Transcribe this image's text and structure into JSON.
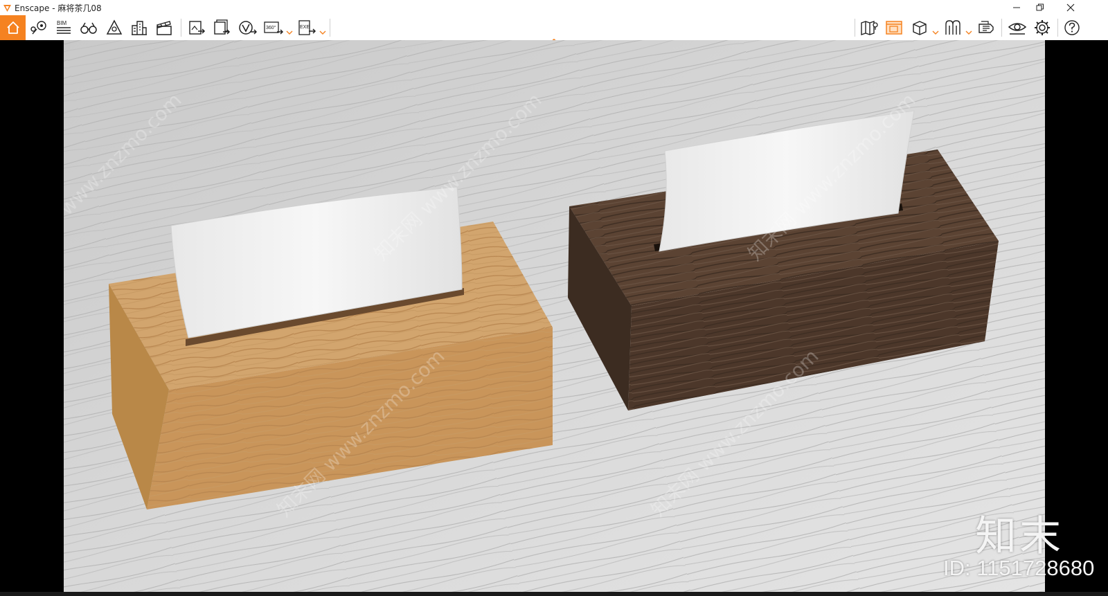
{
  "window": {
    "title": "Enscape - 麻将茶几08",
    "controls": [
      "minimize-icon",
      "restore-icon",
      "close-icon"
    ]
  },
  "toolbar": {
    "home_icon": "home-icon",
    "left_tools": [
      {
        "name": "views-icon"
      },
      {
        "name": "bim-list-icon",
        "label": "BIM"
      },
      {
        "name": "binoculars-icon"
      },
      {
        "name": "asset-library-icon"
      },
      {
        "name": "city-icon"
      },
      {
        "name": "clapperboard-icon"
      },
      {
        "name": "render-image-icon"
      },
      {
        "name": "batch-render-icon"
      },
      {
        "name": "vr-link-icon"
      },
      {
        "name": "panorama-360-icon",
        "label": "360°"
      },
      {
        "name": "export-exe-icon",
        "label": "EXE"
      }
    ],
    "right_tools": [
      {
        "name": "map-icon"
      },
      {
        "name": "render-window-icon",
        "active": true
      },
      {
        "name": "cube-view-icon"
      },
      {
        "name": "visual-settings-icon"
      },
      {
        "name": "capture-icon"
      },
      {
        "name": "eye-icon"
      },
      {
        "name": "settings-gear-icon"
      },
      {
        "name": "help-icon"
      }
    ],
    "accent_color": "#f58220"
  },
  "viewport": {
    "watermark_logo": "知末",
    "watermark_id": "ID: 1151728680",
    "watermark_diagonal": "知末网 www.znzmo.com"
  }
}
